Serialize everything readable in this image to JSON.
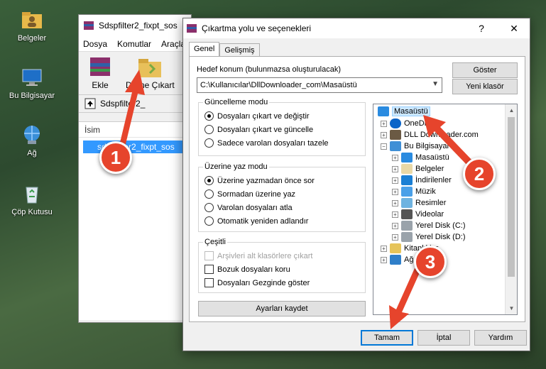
{
  "desktop": {
    "icons": [
      {
        "label": "Belgeler",
        "icon": "folder-user-icon"
      },
      {
        "label": "Bu Bilgisayar",
        "icon": "computer-icon"
      },
      {
        "label": "Ağ",
        "icon": "network-globe-icon"
      },
      {
        "label": "Çöp Kutusu",
        "icon": "recycle-bin-icon"
      }
    ]
  },
  "rar_window": {
    "title": "Sdspfilter2_fixpt_sos",
    "menu": [
      "Dosya",
      "Komutlar",
      "Araçla"
    ],
    "toolbar": {
      "add": "Ekle",
      "extract_to": "Dizine Çıkart"
    },
    "path": "Sdspfilter2_",
    "column_name": "İsim",
    "file_row": "sdspfilter2_fixpt_sos"
  },
  "dialog": {
    "title": "Çıkartma yolu ve seçenekleri",
    "help": "?",
    "close": "✕",
    "tabs": [
      "Genel",
      "Gelişmiş"
    ],
    "dest_label": "Hedef konum (bulunmazsa oluşturulacak)",
    "dest_value": "C:\\Kullanıcılar\\DllDownloader_com\\Masaüstü",
    "show_button": "Göster",
    "new_folder_button": "Yeni klasör",
    "update_mode": {
      "title": "Güncelleme modu",
      "options": [
        "Dosyaları çıkart ve değiştir",
        "Dosyaları çıkart ve güncelle",
        "Sadece varolan dosyaları tazele"
      ],
      "selected": 0
    },
    "overwrite_mode": {
      "title": "Üzerine yaz modu",
      "options": [
        "Üzerine yazmadan önce sor",
        "Sormadan üzerine yaz",
        "Varolan dosyaları atla",
        "Otomatik yeniden adlandır"
      ],
      "selected": 0
    },
    "misc": {
      "title": "Çeşitli",
      "options": [
        "Arşivleri alt klasörlere çıkart",
        "Bozuk dosyaları koru",
        "Dosyaları Gezginde göster"
      ]
    },
    "save_settings": "Ayarları kaydet",
    "tree": [
      {
        "label": "Masaüstü",
        "icon": "desktop-icon",
        "selected": true
      },
      {
        "label": "OneDrive",
        "icon": "cloud-icon"
      },
      {
        "label": "DLL Downloader.com",
        "icon": "user-icon"
      },
      {
        "label": "Bu Bilgisayar",
        "icon": "computer-icon"
      },
      {
        "label": "Masaüstü",
        "icon": "desktop-icon"
      },
      {
        "label": "Belgeler",
        "icon": "documents-icon"
      },
      {
        "label": "İndirilenler",
        "icon": "download-icon"
      },
      {
        "label": "Müzik",
        "icon": "music-icon"
      },
      {
        "label": "Resimler",
        "icon": "pictures-icon"
      },
      {
        "label": "Videolar",
        "icon": "videos-icon"
      },
      {
        "label": "Yerel Disk (C:)",
        "icon": "drive-icon"
      },
      {
        "label": "Yerel Disk (D:)",
        "icon": "drive-icon"
      },
      {
        "label": "Kitaplıklar",
        "icon": "libraries-icon"
      },
      {
        "label": "Ağ",
        "icon": "network-icon"
      }
    ],
    "ok": "Tamam",
    "cancel": "İptal",
    "help_button": "Yardım"
  },
  "annotations": {
    "step1": "1",
    "step2": "2",
    "step3": "3"
  },
  "colors": {
    "accent": "#0078d7",
    "badge": "#e6442c",
    "selection": "#3399ff"
  }
}
